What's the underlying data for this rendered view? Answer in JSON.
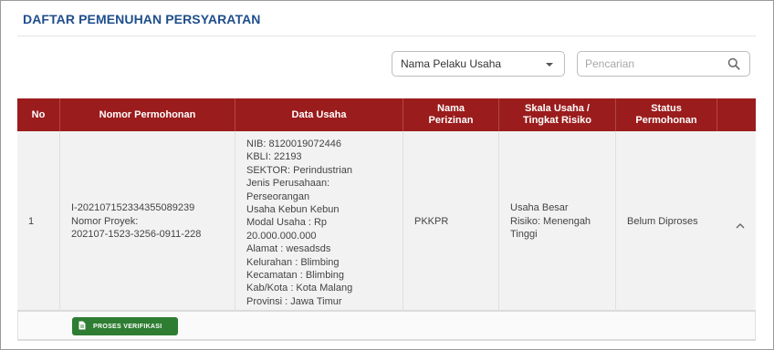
{
  "page": {
    "title": "DAFTAR PEMENUHAN PERSYARATAN"
  },
  "filters": {
    "select_value": "Nama Pelaku Usaha",
    "search_placeholder": "Pencarian",
    "search_value": ""
  },
  "table": {
    "headers": {
      "no": "No",
      "nomor_permohonan": "Nomor Permohonan",
      "data_usaha": "Data Usaha",
      "nama_perizinan_1": "Nama",
      "nama_perizinan_2": "Perizinan",
      "skala_1": "Skala Usaha /",
      "skala_2": "Tingkat Risiko",
      "status_1": "Status",
      "status_2": "Permohonan"
    },
    "rows": [
      {
        "no": "1",
        "nomor_permohonan": {
          "line1": "I-202107152334355089239",
          "line2": "Nomor Proyek:",
          "line3": "202107-1523-3256-0911-228"
        },
        "data_usaha": {
          "l1": "NIB: 8120019072446",
          "l2": "KBLI: 22193",
          "l3": "SEKTOR: Perindustrian",
          "l4": "Jenis Perusahaan:",
          "l5": "Perseorangan",
          "l6": "Usaha Kebun Kebun",
          "l7": "Modal Usaha : Rp",
          "l8": "20.000.000.000",
          "l9": "Alamat : wesadsds",
          "l10": "Kelurahan : Blimbing",
          "l11": "Kecamatan : Blimbing",
          "l12": "Kab/Kota : Kota Malang",
          "l13": "Provinsi : Jawa Timur"
        },
        "nama_perizinan": "PKKPR",
        "skala": {
          "line1": "Usaha Besar",
          "line2": "Risiko: Menengah",
          "line3": "Tinggi"
        },
        "status": "Belum Diproses"
      }
    ]
  },
  "actions": {
    "verify_label": "PROSES VERIFIKASI"
  },
  "colors": {
    "title": "#1f4e8c",
    "header_bg": "#9b1c1c",
    "button_bg": "#2e7d32"
  },
  "icons": {
    "select_caret": "caret-down-icon",
    "search": "search-icon",
    "row_toggle": "chevron-up-icon",
    "button": "document-icon"
  }
}
